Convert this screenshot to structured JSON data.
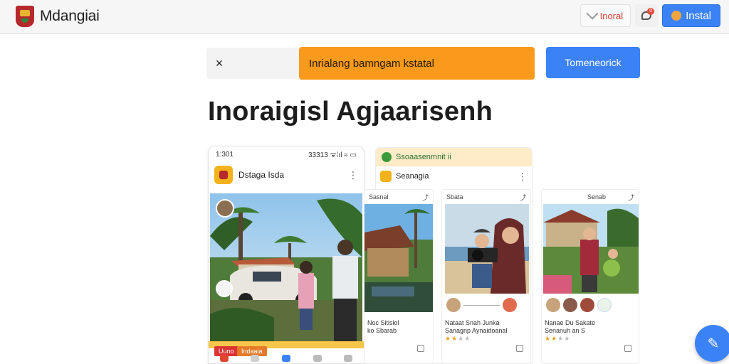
{
  "header": {
    "brand_name": "Mdangiai",
    "install_link": "Inoral",
    "notif_count": "0",
    "install_button": "Instal"
  },
  "banner": {
    "close": "×",
    "message": "Inrialang bamngam kstatal",
    "cta": "Tomeneorick"
  },
  "page": {
    "title": "Inoraigisl Agjaarisenh"
  },
  "phone": {
    "time": "1:301",
    "status_right": "33313  ᯤ⁞ıl ≈ ▭",
    "app_name": "Dstaga  Isda",
    "tag1": "Uuno",
    "tag2": "Indaaia"
  },
  "panel2": {
    "banner_text": "Ssoaasenmnit ii",
    "app_name": "Seanagia"
  },
  "cards": [
    {
      "top": "Sasnal",
      "line1": "Noc Sitisiol",
      "line2": "ko Sbarab"
    },
    {
      "top": "Sbata",
      "line1": "Nataat Snah Junka",
      "line2": "Sanagnp Aynaidoanal"
    },
    {
      "top": "Senab",
      "line1": "Nanae Du Sakate",
      "line2": "Senanuh an S"
    }
  ],
  "colors": {
    "accent_blue": "#3b82f6",
    "banner_orange": "#f99a1c",
    "brand_red": "#b5282c"
  },
  "icons": {
    "fab": "edit-icon"
  }
}
